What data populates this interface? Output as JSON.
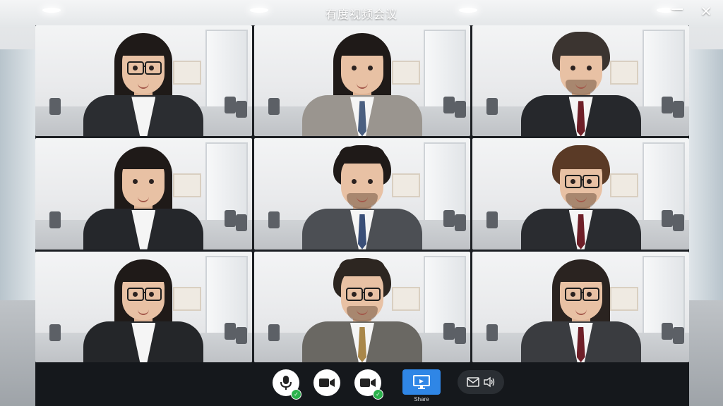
{
  "window": {
    "title": "有度视频会议",
    "minimize_icon": "minimize-icon",
    "close_icon": "close-icon",
    "close_glyph": "✕"
  },
  "participants": [
    {
      "gender": "female",
      "hair_color": "#1f1a18",
      "suit_color": "#2b2d31",
      "glasses": true,
      "beard": false,
      "tie_color": null,
      "hair_style": "long"
    },
    {
      "gender": "female",
      "hair_color": "#1f1a18",
      "suit_color": "#9a958f",
      "glasses": false,
      "beard": false,
      "tie_color": "#4a5f80",
      "hair_style": "long"
    },
    {
      "gender": "male",
      "hair_color": "#3b3430",
      "suit_color": "#26282c",
      "glasses": false,
      "beard": true,
      "tie_color": "#6e1f28",
      "hair_style": "medium"
    },
    {
      "gender": "female",
      "hair_color": "#1f1a18",
      "suit_color": "#25272b",
      "glasses": false,
      "beard": false,
      "tie_color": null,
      "hair_style": "long"
    },
    {
      "gender": "male",
      "hair_color": "#1f1a18",
      "suit_color": "#4c4f54",
      "glasses": false,
      "beard": true,
      "tie_color": "#3a4f78",
      "hair_style": "spiky"
    },
    {
      "gender": "male",
      "hair_color": "#5a3a26",
      "suit_color": "#2a2c30",
      "glasses": true,
      "beard": true,
      "tie_color": "#6e1f28",
      "hair_style": "short"
    },
    {
      "gender": "female",
      "hair_color": "#1f1a18",
      "suit_color": "#242629",
      "glasses": true,
      "beard": false,
      "tie_color": null,
      "hair_style": "long"
    },
    {
      "gender": "male",
      "hair_color": "#2d2621",
      "suit_color": "#6a6863",
      "glasses": true,
      "beard": true,
      "tie_color": "#a9874a",
      "hair_style": "spiky"
    },
    {
      "gender": "female",
      "hair_color": "#2a2320",
      "suit_color": "#3a3c40",
      "glasses": true,
      "beard": false,
      "tie_color": "#6e1f28",
      "hair_style": "long"
    }
  ],
  "controls": {
    "mic": {
      "icon": "microphone-icon",
      "status": "on",
      "status_glyph": "✓"
    },
    "camera_1": {
      "icon": "video-camera-icon"
    },
    "camera_2": {
      "icon": "video-camera-icon",
      "status": "on",
      "status_glyph": "✓"
    },
    "share_screen": {
      "icon": "monitor-icon",
      "label": "Share",
      "accent": "#2f86e6"
    },
    "messages": {
      "icon_1": "envelope-icon",
      "icon_2": "speaker-icon"
    }
  },
  "colors": {
    "control_bar": "#15181c",
    "status_ok": "#2bb24c"
  }
}
